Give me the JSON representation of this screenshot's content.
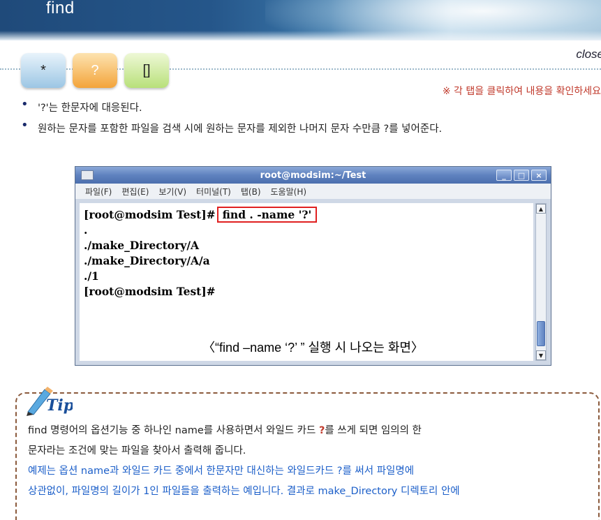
{
  "header": {
    "title": "find",
    "close_label": "close"
  },
  "tabs": [
    {
      "label": "*"
    },
    {
      "label": "?"
    },
    {
      "label": "[]"
    }
  ],
  "instruction": "※ 각 탭을 클릭하여 내용을 확인하세요",
  "bullets": [
    "'?'는 한문자에 대응된다.",
    "원하는 문자를 포함한 파일을 검색 시에 원하는 문자를 제외한 나머지 문자 수만큼 ?를 넣어준다."
  ],
  "terminal": {
    "title": "root@modsim:~/Test",
    "controls": [
      "_",
      "□",
      "×"
    ],
    "menu": [
      "파일(F)",
      "편집(E)",
      "보기(V)",
      "터미널(T)",
      "탭(B)",
      "도움말(H)"
    ],
    "prompt": "[root@modsim Test]#",
    "command": "find . -name '?'",
    "output": [
      ".",
      "./make_Directory/A",
      "./make_Directory/A/a",
      "./1",
      "[root@modsim Test]#"
    ],
    "caption": "〈“find  –name ‘?’ ” 실행 시 나오는 화면〉"
  },
  "tip": {
    "label": "Tip",
    "line1_before": "find 명령어의 옵션기능 중 하나인 name를 사용하면서 와일드 카드 ",
    "line1_mark": "?",
    "line1_after": "를 쓰게 되면 임의의 한",
    "line2": "문자라는 조건에 맞는 파일을 찾아서 출력해 줍니다.",
    "line3": "예제는 옵션 name과 와일드 카드 중에서 한문자만 대신하는 와일드카드 ?를 써서 파일명에",
    "line4": "상관없이, 파일명의 길이가 1인 파일들을 출력하는 예입니다. 결과로 make_Directory 디렉토리 안에"
  },
  "colors": {
    "banner": "#1f4a7a",
    "instruction": "#c0392b",
    "tip_border": "#8b5a3c",
    "tip_blue_text": "#1c5fc9",
    "highlight": "#e02020"
  }
}
